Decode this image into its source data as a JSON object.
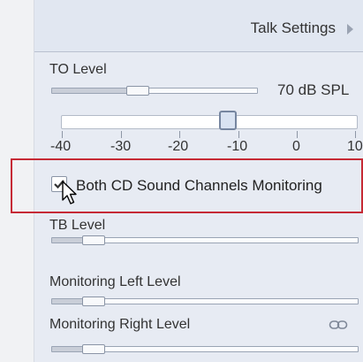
{
  "header": {
    "title": "Talk Settings",
    "arrow_icon": "chevron-right-icon"
  },
  "to_level": {
    "label": "TO Level",
    "value_text": "70 dB SPL",
    "slider_position": 0.4
  },
  "big_slider": {
    "value": -15,
    "min": -40,
    "max": 10,
    "ticks": [
      "-40",
      "-30",
      "-20",
      "-10",
      "0",
      "10"
    ]
  },
  "both_cd": {
    "label": "Both CD Sound Channels Monitoring",
    "checked": true
  },
  "tb_level": {
    "label": "TB Level",
    "slider_position": 0.12
  },
  "monitoring_left": {
    "label": "Monitoring Left Level",
    "slider_position": 0.12
  },
  "monitoring_right": {
    "label": "Monitoring Right Level",
    "slider_position": 0.12,
    "icon": "link-icon"
  },
  "colors": {
    "panel_bg": "#e7ebf3",
    "highlight_border": "#c62a35"
  }
}
